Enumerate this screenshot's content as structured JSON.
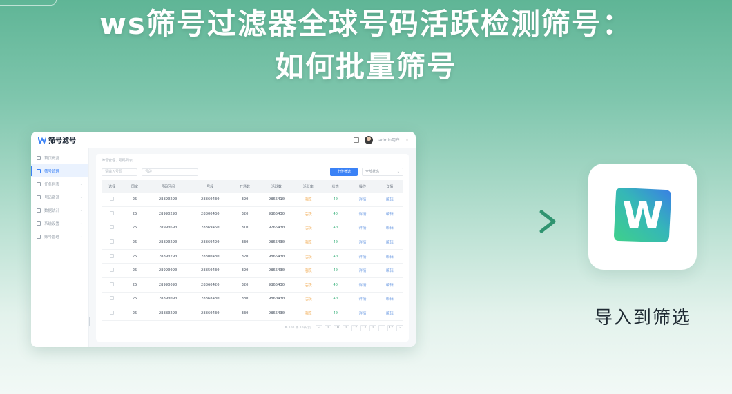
{
  "headline": {
    "line1": "ws筛号过滤器全球号码活跃检测筛号：",
    "line2": "如何批量筛号"
  },
  "app": {
    "logo_text": "筛号滤号",
    "user_name": "admin用户",
    "sidebar": [
      {
        "label": "首页概览",
        "icon": "home-icon"
      },
      {
        "label": "筛号管理",
        "icon": "filter-icon",
        "active": true
      },
      {
        "label": "任务列表",
        "icon": "list-icon"
      },
      {
        "label": "号码资源",
        "icon": "phone-icon"
      },
      {
        "label": "数据统计",
        "icon": "chart-icon"
      },
      {
        "label": "系统设置",
        "icon": "gear-icon"
      },
      {
        "label": "账号管理",
        "icon": "user-icon"
      }
    ],
    "breadcrumb": "筛号管理 / 号码列表",
    "filters": {
      "input1_placeholder": "请输入号码",
      "input2_placeholder": "号段",
      "primary_button": "上传筛选",
      "select_value": "全部状态"
    },
    "table": {
      "headers": [
        "选择",
        "国家",
        "号码区间",
        "号段",
        "开通数",
        "活跃数",
        "活跃率",
        "状态",
        "操作",
        "详情"
      ],
      "rows": [
        [
          "25",
          "28890290",
          "28860430",
          "320",
          "9865410",
          "活跃",
          "40",
          "详情",
          "编辑"
        ],
        [
          "25",
          "28990290",
          "28800430",
          "320",
          "9865430",
          "活跃",
          "40",
          "详情",
          "编辑"
        ],
        [
          "25",
          "28990690",
          "28869450",
          "310",
          "9265430",
          "活跃",
          "40",
          "详情",
          "编辑"
        ],
        [
          "25",
          "28890290",
          "28869420",
          "330",
          "9865430",
          "活跃",
          "40",
          "详情",
          "编辑"
        ],
        [
          "25",
          "28890290",
          "28800430",
          "320",
          "9865430",
          "活跃",
          "40",
          "详情",
          "编辑"
        ],
        [
          "25",
          "28990090",
          "28850430",
          "320",
          "9865430",
          "活跃",
          "40",
          "详情",
          "编辑"
        ],
        [
          "25",
          "28990090",
          "28860420",
          "320",
          "9865430",
          "活跃",
          "40",
          "详情",
          "编辑"
        ],
        [
          "25",
          "28890090",
          "28868430",
          "330",
          "9860430",
          "活跃",
          "40",
          "详情",
          "编辑"
        ],
        [
          "25",
          "28880290",
          "28860430",
          "330",
          "9865430",
          "活跃",
          "40",
          "详情",
          "编辑"
        ]
      ]
    },
    "pager": {
      "text": "共 100 条 10条/页",
      "pages": [
        "‹",
        "1",
        "10",
        "1",
        "12",
        "13",
        "1",
        "...",
        "12",
        "›"
      ]
    }
  },
  "target": {
    "caption": "导入到筛选",
    "icon_letter": "W"
  },
  "colors": {
    "brand_blue": "#3b82f6",
    "brand_green": "#2fa37a",
    "arrow": "#3a9e7a"
  }
}
